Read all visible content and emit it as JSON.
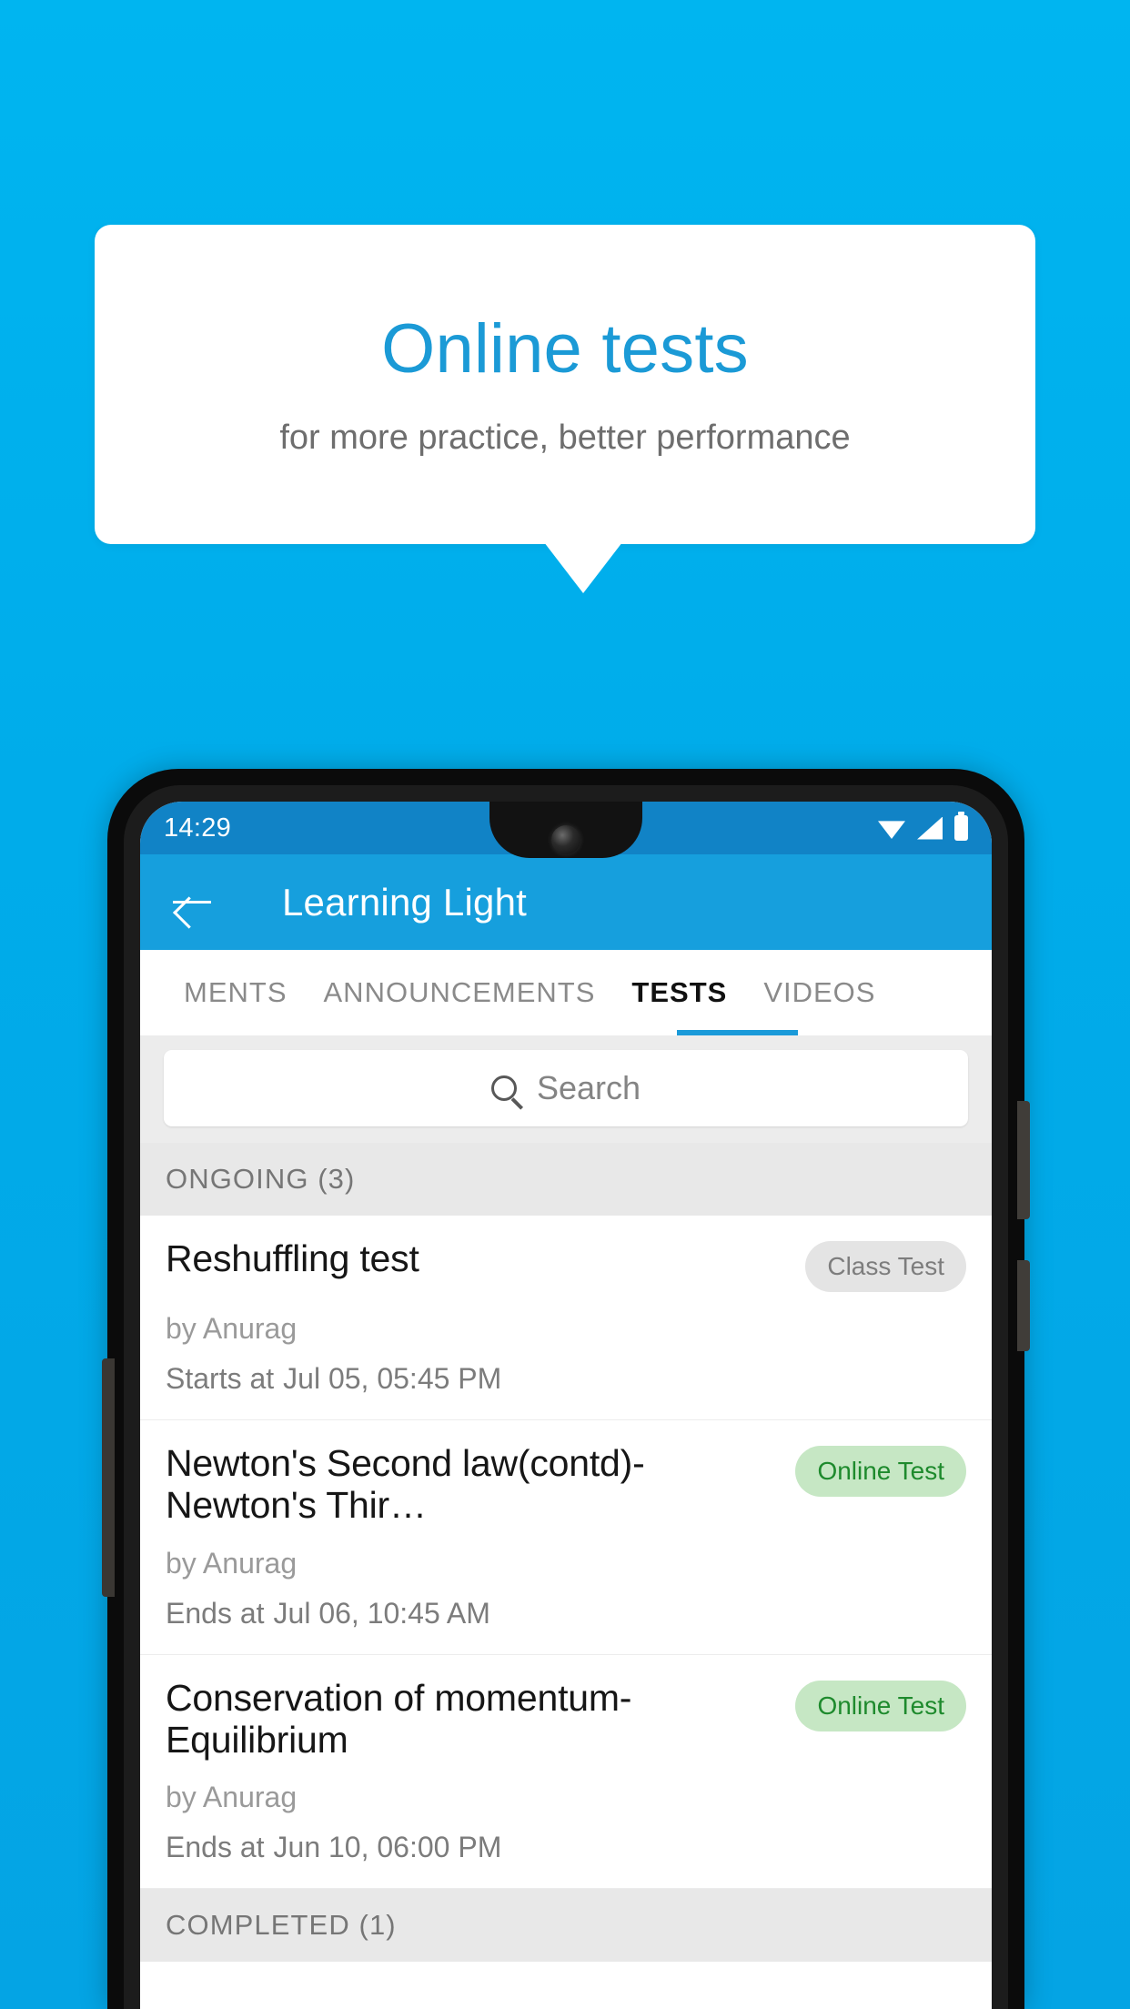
{
  "promo": {
    "title": "Online tests",
    "subtitle": "for more practice, better performance",
    "title_color": "#1b9ad6",
    "background_color": "#00b3ef"
  },
  "phone": {
    "status_bar": {
      "time": "14:29",
      "icons": [
        "wifi-icon",
        "signal-icon",
        "battery-icon"
      ],
      "background_color": "#1183c6"
    },
    "app_bar": {
      "back_icon": "back-arrow-icon",
      "title": "Learning Light",
      "background_color": "#169fdd"
    },
    "tabs": [
      {
        "label": "MENTS",
        "active": false
      },
      {
        "label": "ANNOUNCEMENTS",
        "active": false
      },
      {
        "label": "TESTS",
        "active": true
      },
      {
        "label": "VIDEOS",
        "active": false
      }
    ],
    "search": {
      "icon": "search-icon",
      "placeholder": "Search",
      "value": ""
    },
    "sections": [
      {
        "header": "ONGOING (3)",
        "items": [
          {
            "title": "Reshuffling test",
            "badge": "Class Test",
            "badge_type": "class",
            "author": "by Anurag",
            "time_label": "Starts at",
            "time_value": "Jul 05, 05:45 PM"
          },
          {
            "title": "Newton's Second law(contd)-Newton's Thir…",
            "badge": "Online Test",
            "badge_type": "online",
            "author": "by Anurag",
            "time_label": "Ends at",
            "time_value": "Jul 06, 10:45 AM"
          },
          {
            "title": "Conservation of momentum-Equilibrium",
            "badge": "Online Test",
            "badge_type": "online",
            "author": "by Anurag",
            "time_label": "Ends at",
            "time_value": "Jun 10, 06:00 PM"
          }
        ]
      },
      {
        "header": "COMPLETED (1)",
        "items": []
      }
    ]
  }
}
